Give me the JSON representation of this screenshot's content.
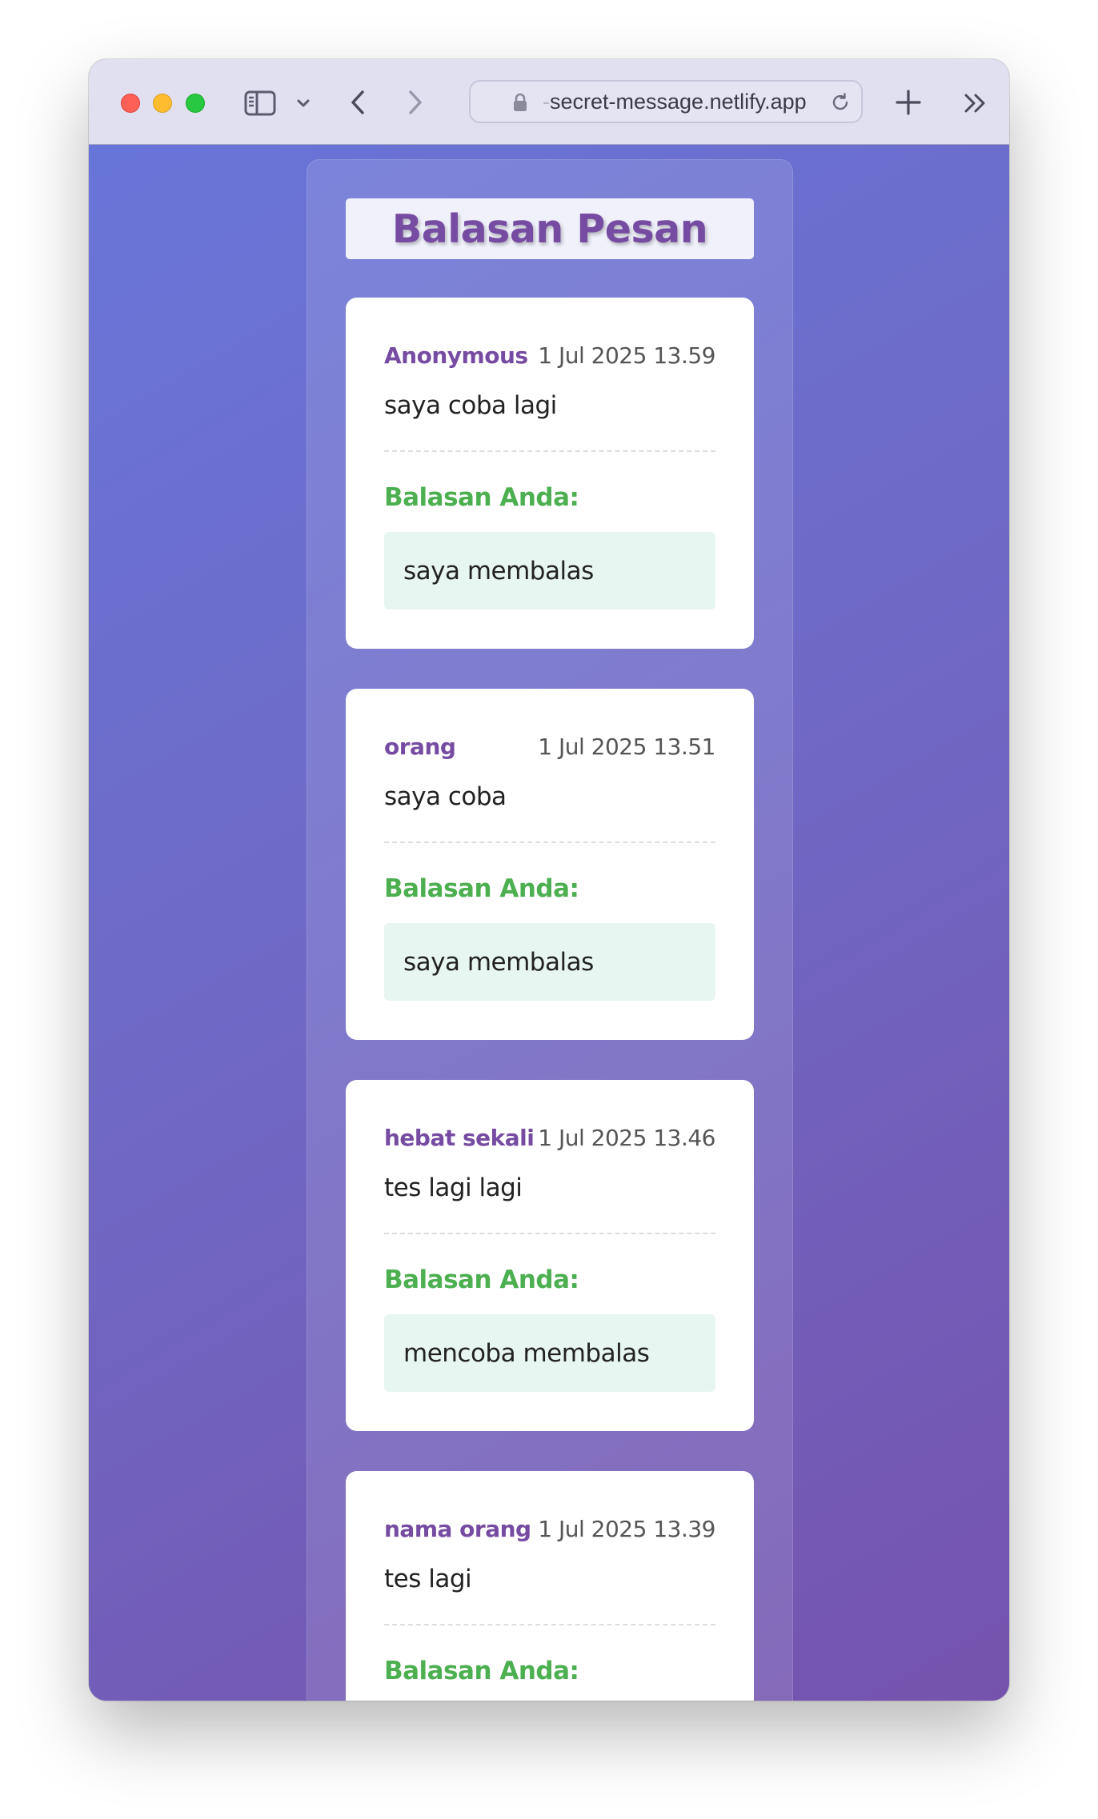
{
  "browser": {
    "url_prefix_faded": "-",
    "url": "secret-message.netlify.app",
    "icons": [
      "sidebar-icon",
      "chevron-down-icon",
      "back-icon",
      "forward-icon",
      "lock-icon",
      "reload-icon",
      "new-tab-icon",
      "more-icon"
    ]
  },
  "page": {
    "title": "Balasan Pesan",
    "colors": {
      "title": "#764ba2",
      "sender": "#764ba2",
      "reply_label": "#4caf50",
      "reply_bg": "#e8f6f1",
      "gradient_start": "#6875d8",
      "gradient_end": "#7553ad"
    }
  },
  "messages": [
    {
      "sender": "Anonymous",
      "time": "1 Jul 2025 13.59",
      "text": "saya coba lagi",
      "reply_label": "Balasan Anda:",
      "reply": "saya membalas"
    },
    {
      "sender": "orang",
      "time": "1 Jul 2025 13.51",
      "text": "saya coba",
      "reply_label": "Balasan Anda:",
      "reply": "saya membalas"
    },
    {
      "sender": "hebat sekali",
      "time": "1 Jul 2025 13.46",
      "text": "tes lagi lagi",
      "reply_label": "Balasan Anda:",
      "reply": "mencoba membalas"
    },
    {
      "sender": "nama orang",
      "time": "1 Jul 2025 13.39",
      "text": "tes lagi",
      "reply_label": "Balasan Anda:",
      "reply": ""
    }
  ]
}
